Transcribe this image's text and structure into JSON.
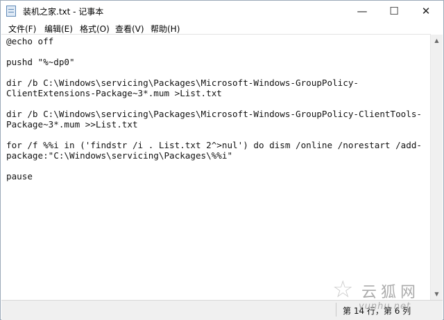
{
  "window": {
    "title": "装机之家.txt - 记事本",
    "minimize_glyph": "—",
    "maximize_glyph": "☐",
    "close_glyph": "✕"
  },
  "menu": {
    "file": "文件(F)",
    "edit": "编辑(E)",
    "format": "格式(O)",
    "view": "查看(V)",
    "help": "帮助(H)"
  },
  "editor": {
    "lines": [
      "@echo off",
      "",
      "pushd \"%~dp0\"",
      "",
      "dir /b C:\\Windows\\servicing\\Packages\\Microsoft-Windows-GroupPolicy-",
      "ClientExtensions-Package~3*.mum >List.txt",
      "",
      "dir /b C:\\Windows\\servicing\\Packages\\Microsoft-Windows-GroupPolicy-ClientTools-",
      "Package~3*.mum >>List.txt",
      "",
      "for /f %%i in ('findstr /i . List.txt 2^>nul') do dism /online /norestart /add-",
      "package:\"C:\\Windows\\servicing\\Packages\\%%i\"",
      "",
      "pause"
    ]
  },
  "scrollbar": {
    "up_glyph": "▲",
    "down_glyph": "▼"
  },
  "status": {
    "position": "第 14 行，第 6 列"
  },
  "watermark": {
    "star_glyph": "☆",
    "text": "云狐网",
    "url": "yunhu.net"
  }
}
